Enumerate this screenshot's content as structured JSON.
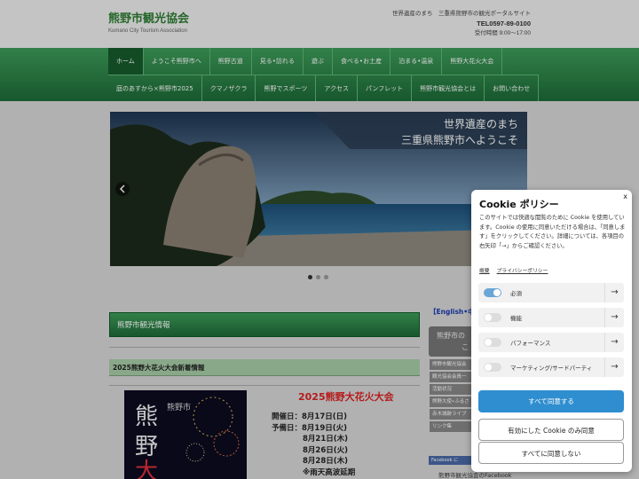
{
  "header": {
    "site_title": "熊野市観光協会",
    "site_subtitle": "Kumano City Tourism Association",
    "tagline": "世界遺産のまち　三重県熊野市の観光ポータルサイト",
    "tel": "TEL0597-89-0100",
    "hours": "受付時間 9:00～17:00"
  },
  "nav": {
    "row1": [
      "ホーム",
      "ようこそ熊野市へ",
      "熊野古道",
      "見る•訪れる",
      "遊ぶ",
      "食べる•お土産",
      "泊まる•温泉",
      "熊野大花火大会"
    ],
    "row2": [
      "庭のあすから×熊野市2025",
      "クマノザクラ",
      "熊野でスポーツ",
      "アクセス",
      "パンフレット",
      "熊野市観光協会とは",
      "お問い合わせ"
    ]
  },
  "slider": {
    "caption_line1": "世界遺産のまち",
    "caption_line2": "三重県熊野市へようこそ",
    "prev_icon": "chevron-left-icon",
    "next_icon": "chevron-right-icon",
    "dots": 3,
    "active_dot": 0
  },
  "main": {
    "section_title": "熊野市観光情報",
    "subsection_title": "2025熊野大花火大会新着情報",
    "poster_text": "熊野大花火",
    "poster_subtext": "熊野市",
    "event_title": "2025熊野大花火大会",
    "event_lines": [
      "開催日：8月17日(日)",
      "予備日：8月19日(火)",
      "8月21日(木)",
      "8月26日(火)",
      "8月28日(木)",
      "※雨天高波延期"
    ]
  },
  "sidebar": {
    "english_link": "【English•中",
    "box_line1": "熊野市の",
    "box_line2": "こ",
    "items": [
      "熊野市観光協会",
      "観光協会会員一",
      "活動状況",
      "熊野大使•ふるさ",
      "赤木城跡ライブ",
      "リンク集"
    ],
    "facebook_btn": "Facebook に",
    "facebook_line": "熊野市観光協会のFacebook"
  },
  "cookie": {
    "close": "x",
    "title": "Cookie ポリシー",
    "description": "このサイトでは快適な閲覧のために Cookie を使用しています。Cookie の使用に同意いただける場合は、「同意します」をクリックしてください。詳細については、各項目の右矢印「→」からご確認ください。",
    "link_overview": "概要",
    "link_privacy": "プライバシーポリシー",
    "categories": [
      {
        "label": "必須",
        "enabled": true
      },
      {
        "label": "機能",
        "enabled": false
      },
      {
        "label": "パフォーマンス",
        "enabled": false
      },
      {
        "label": "マーケティング/サードパーティ",
        "enabled": false
      }
    ],
    "accept_all": "すべて同意する",
    "accept_selected": "有効にした Cookie のみ同意",
    "reject_all": "すべてに同意しない",
    "colors": {
      "primary": "#2f8ecf",
      "nav_green": "#2e8b4a",
      "title_green": "#2e7d32"
    }
  }
}
